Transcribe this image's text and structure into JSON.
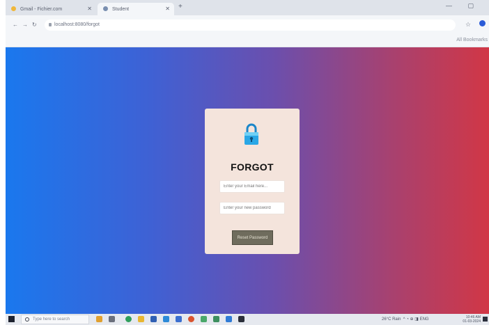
{
  "browser": {
    "tabs": [
      {
        "label": "Gmail - Fichier.com"
      },
      {
        "label": "Student"
      }
    ],
    "new_tab": "+",
    "window_controls": "— ▢",
    "address": "localhost:8080/forgot",
    "bookmarks_all": "All Bookmarks"
  },
  "page": {
    "title": "FORGOT",
    "email_placeholder": "Enter your Email here...",
    "password_placeholder": "Enter your new password",
    "reset_button": "Reset Password"
  },
  "taskbar": {
    "search_placeholder": "Type here to search",
    "weather": "26°C Rain",
    "tray": "^ ◔ ⊕ ◨ ENG",
    "time": "10:46 AM",
    "date": "01-03-2024"
  },
  "colors": {
    "gradient_left": "#1a78ee",
    "gradient_right": "#d13746",
    "card_bg": "#f4e4dc",
    "button_bg": "#6f6c5d",
    "lock_blue": "#2aa7e6"
  }
}
